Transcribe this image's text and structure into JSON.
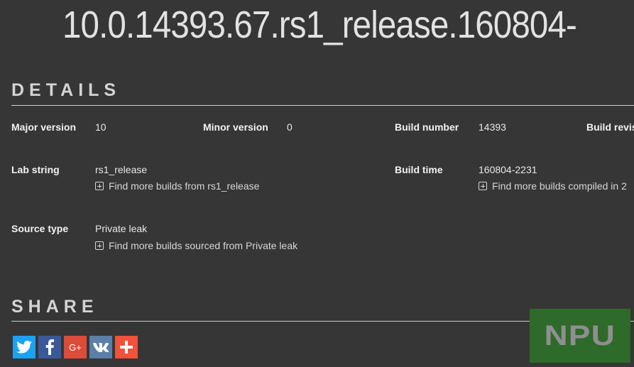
{
  "header": {
    "build_string": "10.0.14393.67.rs1_release.160804-"
  },
  "details": {
    "heading": "DETAILS",
    "fields": {
      "major_version": {
        "label": "Major version",
        "value": "10"
      },
      "minor_version": {
        "label": "Minor version",
        "value": "0"
      },
      "build_number": {
        "label": "Build number",
        "value": "14393"
      },
      "build_revision": {
        "label": "Build revis"
      },
      "lab_string": {
        "label": "Lab string",
        "value": "rs1_release",
        "link": "Find more builds from rs1_release"
      },
      "build_time": {
        "label": "Build time",
        "value": "160804-2231",
        "link": "Find more builds compiled in 2"
      },
      "source_type": {
        "label": "Source type",
        "value": "Private leak",
        "link": "Find more builds sourced from Private leak"
      }
    }
  },
  "share": {
    "heading": "SHARE",
    "buttons": [
      {
        "name": "twitter",
        "icon": "twitter-icon",
        "color": "#1da1f2"
      },
      {
        "name": "facebook",
        "icon": "facebook-icon",
        "color": "#3b5998"
      },
      {
        "name": "google-plus",
        "icon": "google-plus-icon",
        "label": "G+",
        "color": "#dd4b39"
      },
      {
        "name": "vk",
        "icon": "vk-icon",
        "color": "#5b7fa6"
      },
      {
        "name": "more",
        "icon": "plus-icon",
        "color": "#f0523c"
      }
    ]
  },
  "watermark": {
    "text": "NPU",
    "color": "#2e6a2a"
  }
}
